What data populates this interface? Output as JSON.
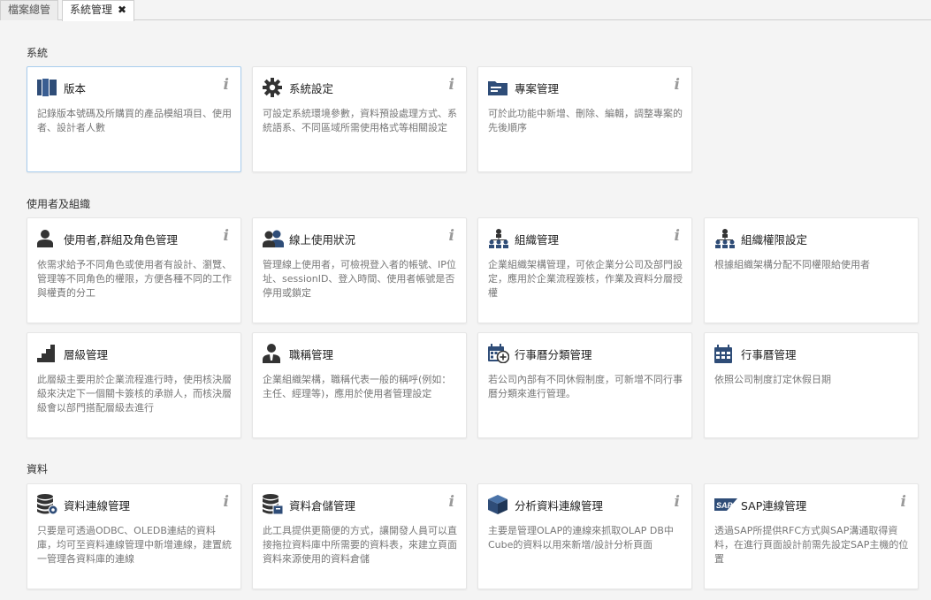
{
  "tabs": [
    {
      "label": "檔案總管"
    },
    {
      "label": "系統管理",
      "close": "✖"
    }
  ],
  "info_glyph": "i",
  "sections": [
    {
      "title": "系統",
      "cards": [
        {
          "title": "版本",
          "icon": "book-icon",
          "desc": "記錄版本號碼及所購買的產品模組項目、使用者、設計者人數"
        },
        {
          "title": "系統設定",
          "icon": "gear-icon",
          "desc": "可設定系統環境參數，資料預設處理方式、系統語系、不同區域所需使用格式等相關設定"
        },
        {
          "title": "專案管理",
          "icon": "folder-icon",
          "desc": "可於此功能中新增、刪除、編輯，調整專案的先後順序"
        }
      ]
    },
    {
      "title": "使用者及組織",
      "cards": [
        {
          "title": "使用者,群組及角色管理",
          "icon": "user-icon",
          "desc": "依需求給予不同角色或使用者有設計、瀏覽、管理等不同角色的權限，方便各種不同的工作與權責的分工"
        },
        {
          "title": "線上使用狀況",
          "icon": "users-icon",
          "desc": "管理線上使用者，可檢視登入者的帳號、IP位址、sessionID、登入時間、使用者帳號是否停用或鎖定"
        },
        {
          "title": "組織管理",
          "icon": "org-icon",
          "desc": "企業組織架構管理，可依企業分公司及部門設定，應用於企業流程簽核，作業及資料分層授權"
        },
        {
          "title": "組織權限設定",
          "icon": "org-icon",
          "desc": "根據組織架構分配不同權限給使用者"
        },
        {
          "title": "層級管理",
          "icon": "stairs-icon",
          "desc": "此層級主要用於企業流程進行時，使用核決層級來決定下一個關卡簽核的承辦人，而核決層級會以部門搭配層級去進行"
        },
        {
          "title": "職稱管理",
          "icon": "employee-icon",
          "desc": "企業組織架構，職稱代表一般的稱呼(例如：主任、經理等)，應用於使用者管理設定"
        },
        {
          "title": "行事曆分類管理",
          "icon": "calendar-plus-icon",
          "desc": "若公司內部有不同休假制度，可新增不同行事曆分類來進行管理。"
        },
        {
          "title": "行事曆管理",
          "icon": "calendar-icon",
          "desc": "依照公司制度訂定休假日期"
        }
      ]
    },
    {
      "title": "資料",
      "cards": [
        {
          "title": "資料連線管理",
          "icon": "database-icon",
          "desc": "只要是可透過ODBC、OLEDB連結的資料庫，均可至資料連線管理中新增連線，建置統一管理各資料庫的連線"
        },
        {
          "title": "資料倉儲管理",
          "icon": "warehouse-icon",
          "desc": "此工具提供更簡便的方式，讓開發人員可以直接拖拉資料庫中所需要的資料表，來建立頁面資料來源使用的資料倉儲"
        },
        {
          "title": "分析資料連線管理",
          "icon": "cube-icon",
          "desc": "主要是管理OLAP的連線來抓取OLAP DB中Cube的資料以用來新增/設計分析頁面"
        },
        {
          "title": "SAP連線管理",
          "icon": "sap-icon",
          "icon_text": "SAP",
          "desc": "透過SAP所提供RFC方式與SAP溝通取得資料，在進行頁面設計前需先設定SAP主機的位置"
        }
      ]
    }
  ]
}
